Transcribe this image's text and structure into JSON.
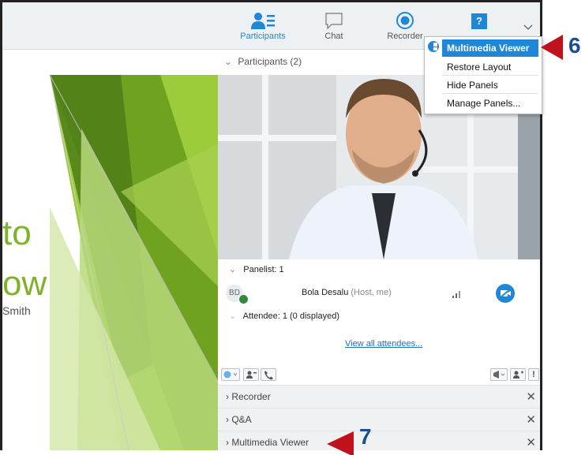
{
  "toolbar": {
    "participants_label": "Participants",
    "chat_label": "Chat",
    "recorder_label": "Recorder"
  },
  "slide": {
    "title_line1": "to",
    "title_line2": "ow",
    "author": "Smith"
  },
  "participants": {
    "header": "Participants (2)",
    "panelist_header": "Panelist: 1",
    "panelist_initials": "BD",
    "panelist_name": "Bola Desalu",
    "panelist_role": "(Host, me)",
    "attendee_header": "Attendee: 1 (0 displayed)",
    "view_all_link": "View all attendees..."
  },
  "panels": [
    {
      "label": "Recorder"
    },
    {
      "label": "Q&A"
    },
    {
      "label": "Multimedia Viewer"
    }
  ],
  "menu": {
    "items": [
      {
        "label": "Multimedia Viewer"
      },
      {
        "label": "Restore Layout"
      },
      {
        "label": "Hide Panels"
      },
      {
        "label": "Manage Panels..."
      }
    ]
  },
  "callouts": {
    "six": "6",
    "seven": "7"
  },
  "colors": {
    "accent": "#1f87d6",
    "slide_green": "#7fb22a",
    "callout_red": "#c0121c",
    "callout_blue": "#1b4f8f"
  }
}
